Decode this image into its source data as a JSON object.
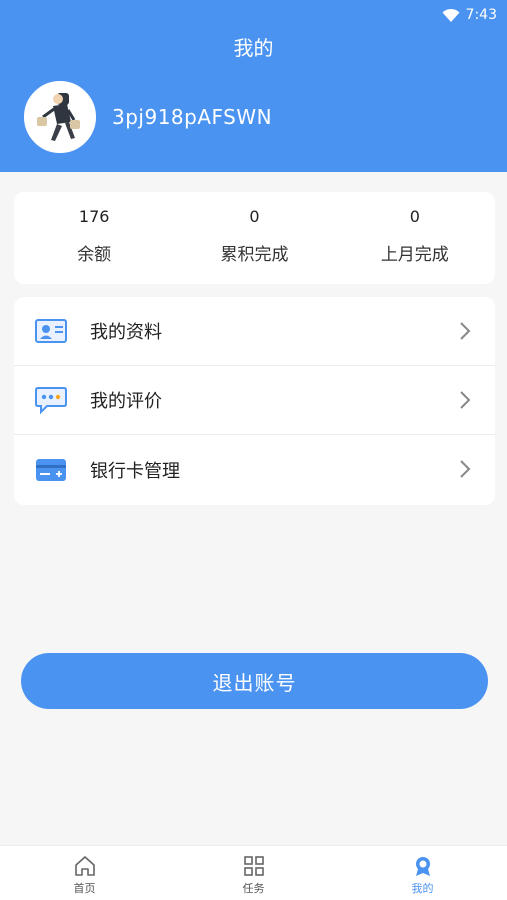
{
  "status_bar": {
    "time": "7:43",
    "wifi_icon": "wifi-icon"
  },
  "header": {
    "title": "我的",
    "username": "3pj918pAFSWN",
    "avatar": "avatar-delivery-person"
  },
  "stats": [
    {
      "value": "176",
      "label": "余额"
    },
    {
      "value": "0",
      "label": "累积完成"
    },
    {
      "value": "0",
      "label": "上月完成"
    }
  ],
  "menu": [
    {
      "label": "我的资料",
      "icon": "profile-card-icon"
    },
    {
      "label": "我的评价",
      "icon": "comment-bubble-icon"
    },
    {
      "label": "银行卡管理",
      "icon": "bank-card-icon"
    }
  ],
  "logout_label": "退出账号",
  "tabs": [
    {
      "label": "首页",
      "icon": "home-icon",
      "active": false
    },
    {
      "label": "任务",
      "icon": "grid-icon",
      "active": false
    },
    {
      "label": "我的",
      "icon": "badge-icon",
      "active": true
    }
  ],
  "colors": {
    "primary": "#4b93f1",
    "background": "#f6f6f6",
    "card": "#ffffff"
  }
}
